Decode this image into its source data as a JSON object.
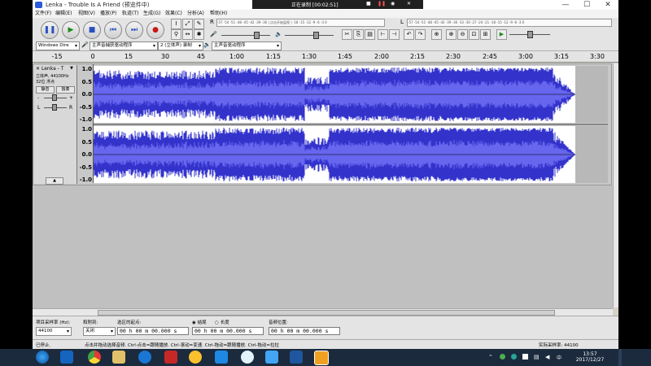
{
  "window": {
    "title": "Lenka - Trouble Is A Friend (预览件中)",
    "minimize": "—",
    "maximize": "☐",
    "close": "✕"
  },
  "recorder": {
    "status": "正在录制 [00:02:51]",
    "stop": "■",
    "pause": "❚❚",
    "camera": "◉",
    "close": "✕"
  },
  "menu": [
    "文件(F)",
    "编辑(E)",
    "视图(V)",
    "播放(P)",
    "轨道(T)",
    "生成(G)",
    "效果(C)",
    "分析(A)",
    "帮助(H)"
  ],
  "transport": {
    "pause": "❚❚",
    "play": "▶",
    "stop": "■",
    "skip_start": "⏮",
    "skip_end": "⏭",
    "record": "●"
  },
  "meters": {
    "record_scale": "-57 -54 -51 -48 -45 -42 -39 -36 | 点击开始监视 | -18 -15 -12 -9 -6 -3 0",
    "play_scale": "-57 -54 -51 -48 -45 -42 -39 -36 -33 -30 -27 -24 -21 -18 -15 -12 -9 -6 -3 0",
    "record_label": "R",
    "play_label": "L"
  },
  "tools": {
    "select": "I",
    "envelope": "⤢",
    "draw": "✎",
    "zoom": "⚲",
    "timeshift": "↔",
    "multi": "✱"
  },
  "edit_tools": {
    "cut": "✂",
    "copy": "⎘",
    "paste": "▤",
    "trim": "⊢",
    "silence": "⊣",
    "undo": "↶",
    "redo": "↷",
    "sync": "⊕",
    "zoom_in": "⊕",
    "zoom_out": "⊖",
    "fit_sel": "⊡",
    "fit_proj": "⊞",
    "play_at_speed": "▶"
  },
  "devices": {
    "host": "Windows Dire",
    "mic_icon": "🎤",
    "input": "主声音捕获驱动程序",
    "channels": "2 (立体声) 录制",
    "output": "主声音驱动程序",
    "speaker_icon": "🔈"
  },
  "ruler": {
    "ticks": [
      "-15",
      "0",
      "15",
      "30",
      "45",
      "1:00",
      "1:15",
      "1:30",
      "1:45",
      "2:00",
      "2:15",
      "2:30",
      "2:45",
      "3:00",
      "3:15",
      "3:30"
    ]
  },
  "track": {
    "name": "Lenka - T",
    "close": "✕",
    "menu_arrow": "▼",
    "info1": "立体声, 44100Hz",
    "info2": "32位 浮点",
    "mute": "静音",
    "solo": "独奏",
    "gain_minus": "-",
    "gain_plus": "+",
    "pan_l": "L",
    "pan_r": "R",
    "collapse": "▲",
    "scale_top": [
      "1.0",
      "0.5",
      "0.0",
      "-0.5",
      "-1.0"
    ],
    "scale_bottom": [
      "1.0",
      "0.5",
      "0.0",
      "-0.5",
      "-1.0"
    ]
  },
  "selection": {
    "rate_label": "项目采样率 (Hz):",
    "rate_value": "44100",
    "snap_label": "和附到:",
    "snap_value": "关闭",
    "start_label": "选区的起点:",
    "end_radio": "结尾",
    "length_radio": "长度",
    "start_value": "00 h 00 m 00.000 s",
    "end_value": "00 h 00 m 00.000 s",
    "pos_label": "音频位置:",
    "pos_value": "00 h 00 m 00.000 s"
  },
  "status": {
    "state": "已停止.",
    "hint": "点击并拖动选择音频. Ctrl-点击=跟随播放. Ctrl-滚动=变速. Ctrl-拖动=跟随播放. Ctrl-拖动=拉拉",
    "actual_rate": "实际采样率: 44100"
  },
  "taskbar": {
    "time": "13:57",
    "date": "2017/12/27"
  },
  "colors": {
    "wave": "#3333cc",
    "wave_core": "#6666ee",
    "bg": "#d4d0c8"
  }
}
